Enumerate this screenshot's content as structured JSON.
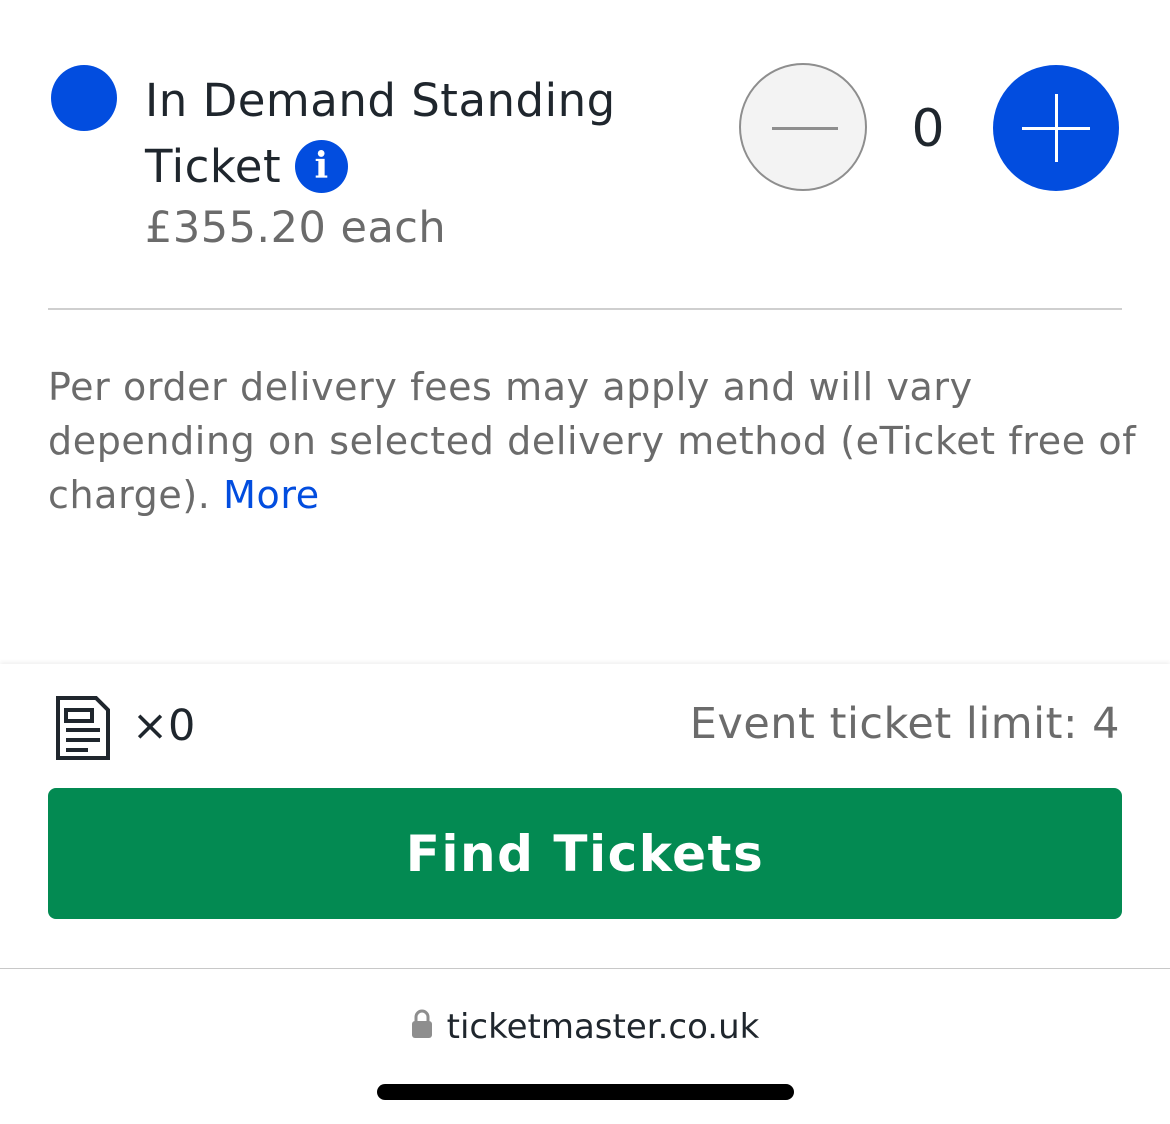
{
  "ticket": {
    "name": "In Demand Standing Ticket",
    "info_glyph": "i",
    "price": "£355.20 each",
    "quantity": "0",
    "color": "#024ddf"
  },
  "fees": {
    "text": "Per order delivery fees may apply and will vary depending on selected delivery method (eTicket free of charge).",
    "more_label": "More"
  },
  "purchase": {
    "count": "×0",
    "limit": "Event ticket limit: 4",
    "button_label": "Find Tickets",
    "button_color": "#038a52"
  },
  "browser": {
    "url": "ticketmaster.co.uk"
  },
  "icons": {
    "ticket_dot": "ticket-type-dot-icon",
    "info": "info-icon",
    "minus": "minus-icon",
    "plus": "plus-icon",
    "tickets": "ticket-list-icon",
    "lock": "lock-icon"
  }
}
